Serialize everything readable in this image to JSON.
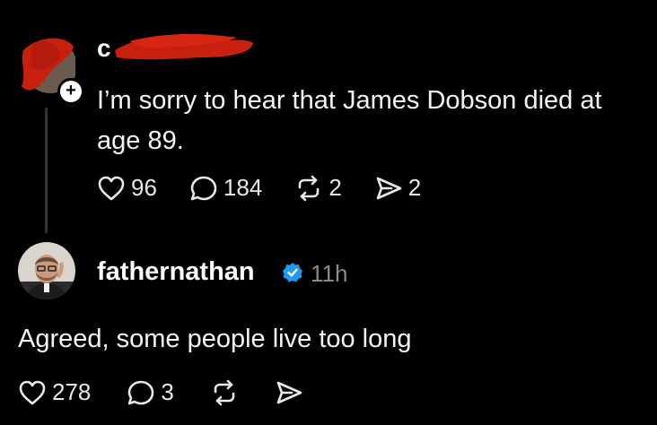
{
  "post1": {
    "author_visible": "c",
    "text": "I’m sorry to hear that James Dobson died at age 89.",
    "likes": "96",
    "replies": "184",
    "reposts": "2",
    "shares": "2"
  },
  "post2": {
    "author": "fathernathan",
    "time": "11h",
    "text": "Agreed, some people live too long",
    "likes": "278",
    "replies": "3"
  },
  "icons": {
    "follow_badge": "plus-icon",
    "verified": "verified-badge-icon",
    "like": "heart-icon",
    "reply": "comment-icon",
    "repost": "repost-icon",
    "share": "send-icon"
  },
  "colors": {
    "background": "#000000",
    "redaction": "#c8200f",
    "verified": "#1d9bf0",
    "muted": "#8a8a8a"
  }
}
